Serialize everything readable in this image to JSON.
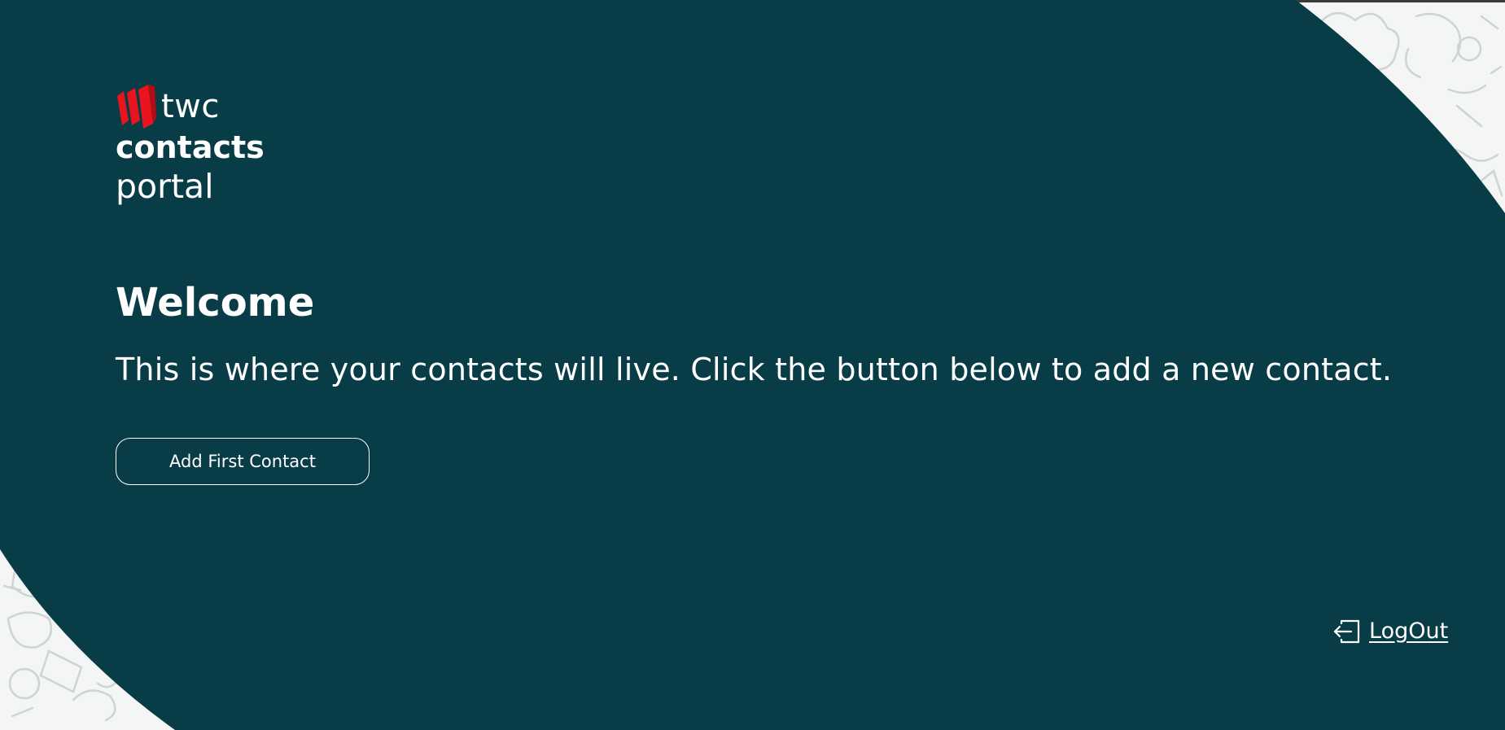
{
  "brand": {
    "twc": "twc",
    "contacts": "contacts",
    "portal": "portal",
    "logo_color": "#e8141e"
  },
  "welcome": {
    "title": "Welcome",
    "message": "This is where your contacts will live. Click the button below to add a new contact."
  },
  "actions": {
    "add_first_contact_label": "Add First Contact",
    "logout_label": "LogOut",
    "logout_icon": "logout-icon"
  },
  "colors": {
    "panel": "#083d47",
    "page_background": "#f4f5f5",
    "text": "#ffffff"
  }
}
